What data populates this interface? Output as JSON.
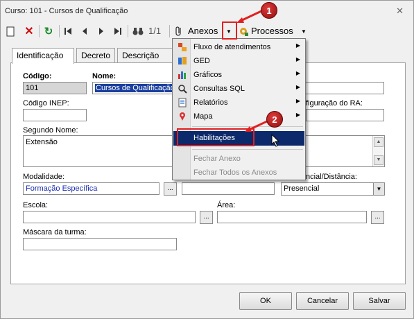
{
  "window": {
    "title": "Curso: 101 - Cursos de Qualificação"
  },
  "toolbar": {
    "page_indicator": "1/1",
    "anexos_label": "Anexos",
    "processos_label": "Processos"
  },
  "tabs": [
    "Identificação",
    "Decreto",
    "Descrição"
  ],
  "form": {
    "codigo": {
      "label": "Código:",
      "value": "101"
    },
    "nome": {
      "label": "Nome:",
      "value": "Cursos de Qualificação"
    },
    "codigo_inep": {
      "label": "Código INEP:",
      "value": ""
    },
    "config_ra": {
      "label": "figuração do RA:",
      "value": ""
    },
    "segundo_nome": {
      "label": "Segundo Nome:",
      "value": "Extensão"
    },
    "modalidade": {
      "label": "Modalidade:",
      "value": "Formação Específica"
    },
    "presencial": {
      "label": "ncial/Distância:",
      "value": "Presencial"
    },
    "escola": {
      "label": "Escola:",
      "value": ""
    },
    "area": {
      "label": "Área:",
      "value": ""
    },
    "mascara": {
      "label": "Máscara da turma:",
      "value": ""
    },
    "ellipsis": "..."
  },
  "buttons": {
    "ok": "OK",
    "cancel": "Cancelar",
    "save": "Salvar"
  },
  "menu": {
    "items": [
      {
        "label": "Fluxo de atendimentos",
        "icon": "flow-icon"
      },
      {
        "label": "GED",
        "icon": "ged-icon"
      },
      {
        "label": "Gráficos",
        "icon": "chart-icon"
      },
      {
        "label": "Consultas SQL",
        "icon": "sql-icon"
      },
      {
        "label": "Relatórios",
        "icon": "report-icon"
      },
      {
        "label": "Mapa",
        "icon": "map-pin-icon"
      }
    ],
    "highlight": "Habilitações",
    "disabled": [
      "Fechar Anexo",
      "Fechar Todos os Anexos"
    ]
  },
  "callouts": [
    "1",
    "2"
  ]
}
